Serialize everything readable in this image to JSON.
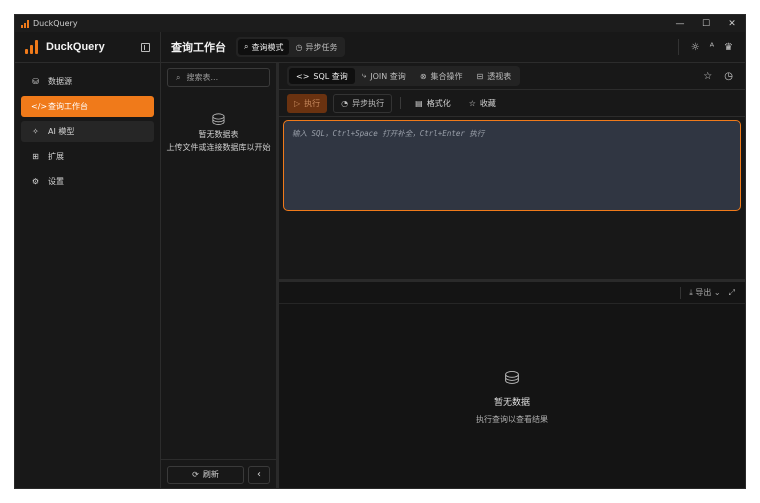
{
  "window": {
    "title": "DuckQuery",
    "controls": [
      "—",
      "☐",
      "✕"
    ]
  },
  "brand": {
    "name": "DuckQuery"
  },
  "header": {
    "title": "查询工作台",
    "mode_tabs": [
      {
        "label": "查询模式",
        "icon": "search-icon",
        "glyph": "⌕"
      },
      {
        "label": "异步任务",
        "icon": "clock-icon",
        "glyph": "◷"
      }
    ],
    "right_icons": [
      {
        "icon": "sun-icon",
        "glyph": "☼"
      },
      {
        "icon": "translate-icon",
        "glyph": "ᴬ"
      },
      {
        "icon": "trophy-icon",
        "glyph": "♛"
      }
    ]
  },
  "sidebar": {
    "items": [
      {
        "label": "数据源",
        "icon": "database-icon",
        "glyph": "⛁",
        "active": false
      },
      {
        "label": "查询工作台",
        "icon": "code-icon",
        "glyph": "</>",
        "active": true
      },
      {
        "label": "AI 模型",
        "icon": "sparkle-icon",
        "glyph": "✧",
        "active": false
      },
      {
        "label": "扩展",
        "icon": "puzzle-icon",
        "glyph": "⊞",
        "active": false
      },
      {
        "label": "设置",
        "icon": "gear-icon",
        "glyph": "⚙",
        "active": false
      }
    ]
  },
  "tables_panel": {
    "search_placeholder": "搜索表...",
    "empty_title": "暂无数据表",
    "empty_hint": "上传文件或连接数据库以开始",
    "refresh_label": "刷新",
    "collapse_glyph": "‹"
  },
  "query_tabs": [
    {
      "label": "SQL 查询",
      "glyph": "<>",
      "active": true
    },
    {
      "label": "JOIN 查询",
      "glyph": "⤷",
      "active": false
    },
    {
      "label": "集合操作",
      "glyph": "⊗",
      "active": false
    },
    {
      "label": "透视表",
      "glyph": "⊟",
      "active": false
    }
  ],
  "query_right_icons": [
    {
      "icon": "star-icon",
      "glyph": "☆"
    },
    {
      "icon": "history-icon",
      "glyph": "◷"
    }
  ],
  "toolbar": {
    "run_label": "执行",
    "async_label": "异步执行",
    "format_label": "格式化",
    "favorite_label": "收藏"
  },
  "editor": {
    "placeholder": "输入 SQL，Ctrl+Space 打开补全，Ctrl+Enter 执行"
  },
  "results": {
    "export_label": "导出",
    "empty_title": "暂无数据",
    "empty_hint": "执行查询以查看结果"
  },
  "colors": {
    "accent": "#f07a1a",
    "background": "#181818",
    "editor_bg": "#303642"
  }
}
